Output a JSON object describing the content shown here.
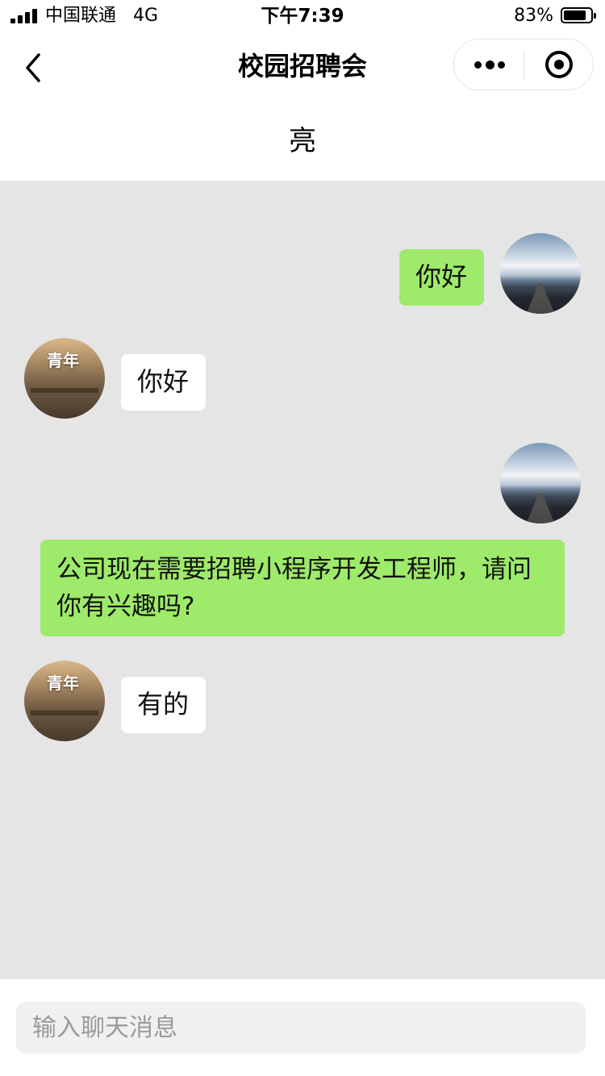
{
  "status_bar": {
    "carrier": "中国联通",
    "network": "4G",
    "time": "下午7:39",
    "battery_percent": "83%",
    "battery_level": 0.83
  },
  "nav": {
    "title": "校园招聘会",
    "back_icon": "chevron-left-icon",
    "more_icon": "more-dots-icon",
    "close_icon": "target-circle-icon"
  },
  "contact": {
    "name": "亮"
  },
  "messages": [
    {
      "side": "right",
      "avatar": "sky-road-photo",
      "text": "你好"
    },
    {
      "side": "left",
      "avatar": "poster-photo",
      "text": "你好"
    },
    {
      "side": "right",
      "avatar": "sky-road-photo",
      "text": "公司现在需要招聘小程序开发工程师，请问你有兴趣吗?"
    },
    {
      "side": "left",
      "avatar": "poster-photo",
      "text": "有的"
    }
  ],
  "avatar_poster_text": "青年",
  "input": {
    "placeholder": "输入聊天消息",
    "value": ""
  },
  "colors": {
    "chat_background": "#e5e5e5",
    "bubble_self": "#9eea6a",
    "bubble_other": "#ffffff"
  }
}
